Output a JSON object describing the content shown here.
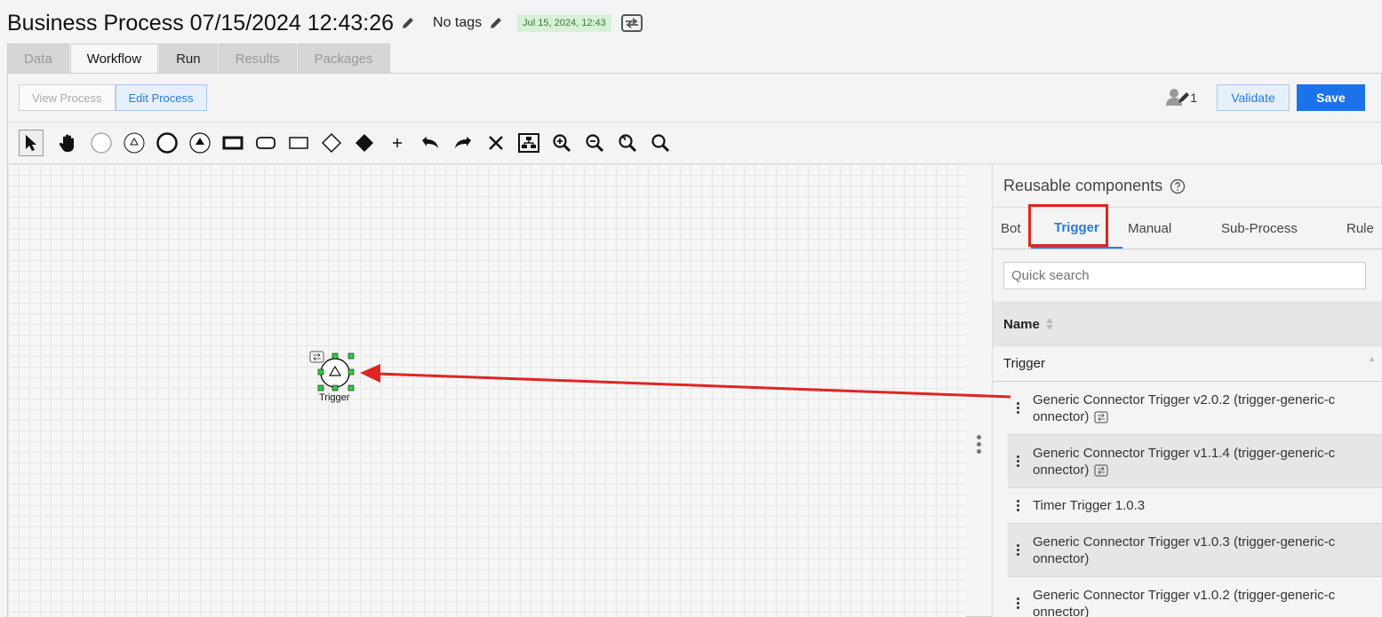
{
  "header": {
    "title": "Business Process 07/15/2024 12:43:26",
    "tags": "No tags",
    "date_badge": "Jul 15, 2024, 12:43"
  },
  "tabs": [
    {
      "label": "Data"
    },
    {
      "label": "Workflow"
    },
    {
      "label": "Run"
    },
    {
      "label": "Results"
    },
    {
      "label": "Packages"
    }
  ],
  "process_bar": {
    "view_label": "View Process",
    "edit_label": "Edit Process"
  },
  "actions": {
    "user_count": "1",
    "validate_label": "Validate",
    "save_label": "Save"
  },
  "canvas": {
    "node_label": "Trigger"
  },
  "side_panel": {
    "title": "Reusable components",
    "tabs": [
      {
        "label": "Bot"
      },
      {
        "label": "Trigger"
      },
      {
        "label": "Manual"
      },
      {
        "label": "Sub-Process"
      },
      {
        "label": "Rule"
      }
    ],
    "search_placeholder": "Quick search",
    "column_header": "Name",
    "group_header": "Trigger",
    "items": [
      {
        "line1": "Generic Connector Trigger v2.0.2 (trigger-generic-c",
        "line2": "onnector)"
      },
      {
        "line1": "Generic Connector Trigger v1.1.4 (trigger-generic-c",
        "line2": "onnector)"
      },
      {
        "line1": "Timer Trigger 1.0.3",
        "line2": ""
      },
      {
        "line1": "Generic Connector Trigger v1.0.3 (trigger-generic-c",
        "line2": "onnector)"
      },
      {
        "line1": "Generic Connector Trigger v1.0.2 (trigger-generic-c",
        "line2": "onnector)"
      }
    ]
  },
  "colors": {
    "accent": "#1a73e8",
    "highlight": "#e02424",
    "badge_bg": "#d8f0d8"
  },
  "icons": [
    "pencil-icon",
    "connector-icon",
    "user-edit-icon",
    "help-icon",
    "sort-icon",
    "kebab-icon"
  ]
}
